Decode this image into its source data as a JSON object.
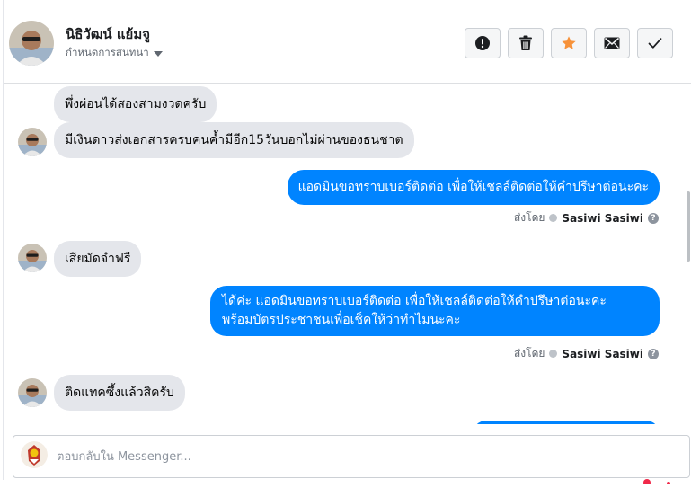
{
  "header": {
    "contact_name": "นิธิวัฒน์ แย้มจู",
    "assign_label": "กำหนดการสนทนา",
    "actions": [
      {
        "icon": "alert-icon",
        "label": "spam"
      },
      {
        "icon": "trash-icon",
        "label": "delete"
      },
      {
        "icon": "star-icon",
        "label": "star"
      },
      {
        "icon": "envelope-icon",
        "label": "mark-unread"
      },
      {
        "icon": "check-icon",
        "label": "done"
      }
    ]
  },
  "messages": [
    {
      "direction": "in",
      "text": "พึ่งผ่อนได้สองสามงวดครับ",
      "avatar": false
    },
    {
      "direction": "in",
      "text": "มีเงินดาวส่งเอกสารครบคนค้ำมีอีก15วันบอกไม่ผ่านของธนชาต",
      "avatar": true
    },
    {
      "direction": "out",
      "text": "แอดมินขอทราบเบอร์ติดต่อ เพื่อให้เชลล์ติดต่อให้คำปรึษาต่อนะคะ",
      "sent_by_label": "ส่งโดย",
      "sender": "Sasiwi Sasiwi"
    },
    {
      "direction": "in",
      "text": "เสียมัดจำฟรี",
      "avatar": true
    },
    {
      "direction": "out",
      "text_line1": "ได้ค่ะ แอดมินขอทราบเบอร์ติดต่อ เพื่อให้เชลล์ติดต่อให้คำปรึษาต่อนะคะ",
      "text_line2": "พร้อมบัตรประชาชนเพื่อเช็คให้ว่าทำไมนะคะ",
      "sent_by_label": "ส่งโดย",
      "sender": "Sasiwi Sasiwi"
    },
    {
      "direction": "in",
      "text": "ติดแทคซึ้งแล้วสิครับ",
      "avatar": true
    }
  ],
  "reply": {
    "placeholder": "ตอบกลับใน Messenger..."
  },
  "colors": {
    "accent": "#0084ff",
    "incoming_bubble": "#e4e6eb",
    "star": "#f7923a"
  }
}
